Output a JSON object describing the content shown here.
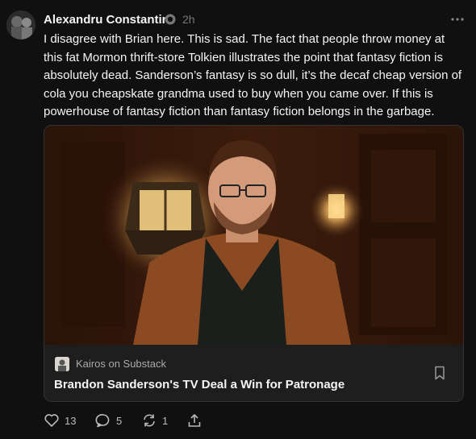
{
  "post": {
    "author": "Alexandru Constantin",
    "time": "2h",
    "text": "I disagree with Brian here. This is sad. The fact that people throw money at this fat Mormon thrift-store Tolkien illustrates the point that fantasy fiction is absolutely dead. Sanderson’s fantasy is so dull, it’s the decaf cheap version of cola you cheapskate grandma used to buy when you came over. If this is powerhouse of fantasy fiction than fantasy fiction belongs in the garbage."
  },
  "link_card": {
    "source": "Kairos on Substack",
    "title": "Brandon Sanderson's TV Deal a Win for Patronage"
  },
  "actions": {
    "likes": "13",
    "replies": "5",
    "reposts": "1"
  },
  "icons": {
    "verified": "verified-badge-icon",
    "more": "more-options-icon",
    "like": "heart-icon",
    "reply": "comment-icon",
    "repost": "repost-icon",
    "share": "share-icon",
    "bookmark": "bookmark-icon"
  },
  "colors": {
    "background": "#101010",
    "text": "#f3f5f7",
    "muted": "#777777",
    "card_footer": "#1e1e1e"
  }
}
